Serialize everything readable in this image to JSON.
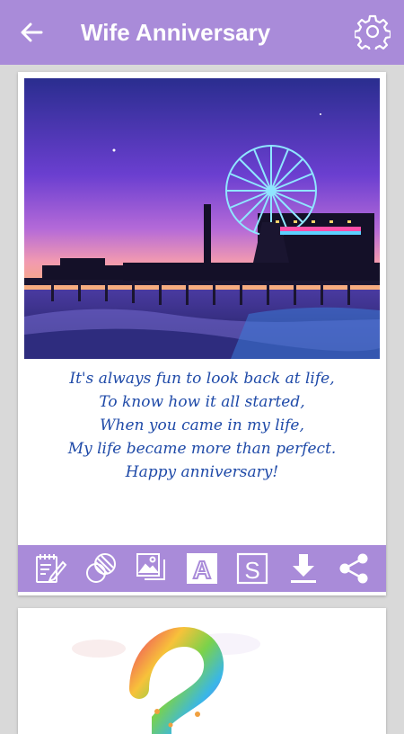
{
  "appbar": {
    "title": "Wife Anniversary",
    "back_icon": "arrow-left-icon",
    "settings_icon": "gear-icon",
    "background_color": "#a98bd9"
  },
  "card": {
    "photo_description_icon": "pier-ferris-wheel-photo",
    "quote_lines": [
      "It's always fun to look back at life,",
      "To know how it all started,",
      "When you came in my life,",
      "My life became more than perfect.",
      "Happy anniversary!"
    ],
    "quote_color": "#1f4aa8",
    "toolbar": [
      {
        "name": "edit-text-icon"
      },
      {
        "name": "texture-icon"
      },
      {
        "name": "gallery-icon"
      },
      {
        "name": "font-icon",
        "label": "A"
      },
      {
        "name": "sticker-icon",
        "label": "S"
      },
      {
        "name": "download-icon"
      },
      {
        "name": "share-icon"
      }
    ]
  },
  "card2": {
    "image_icon": "rainbow-number-image"
  }
}
